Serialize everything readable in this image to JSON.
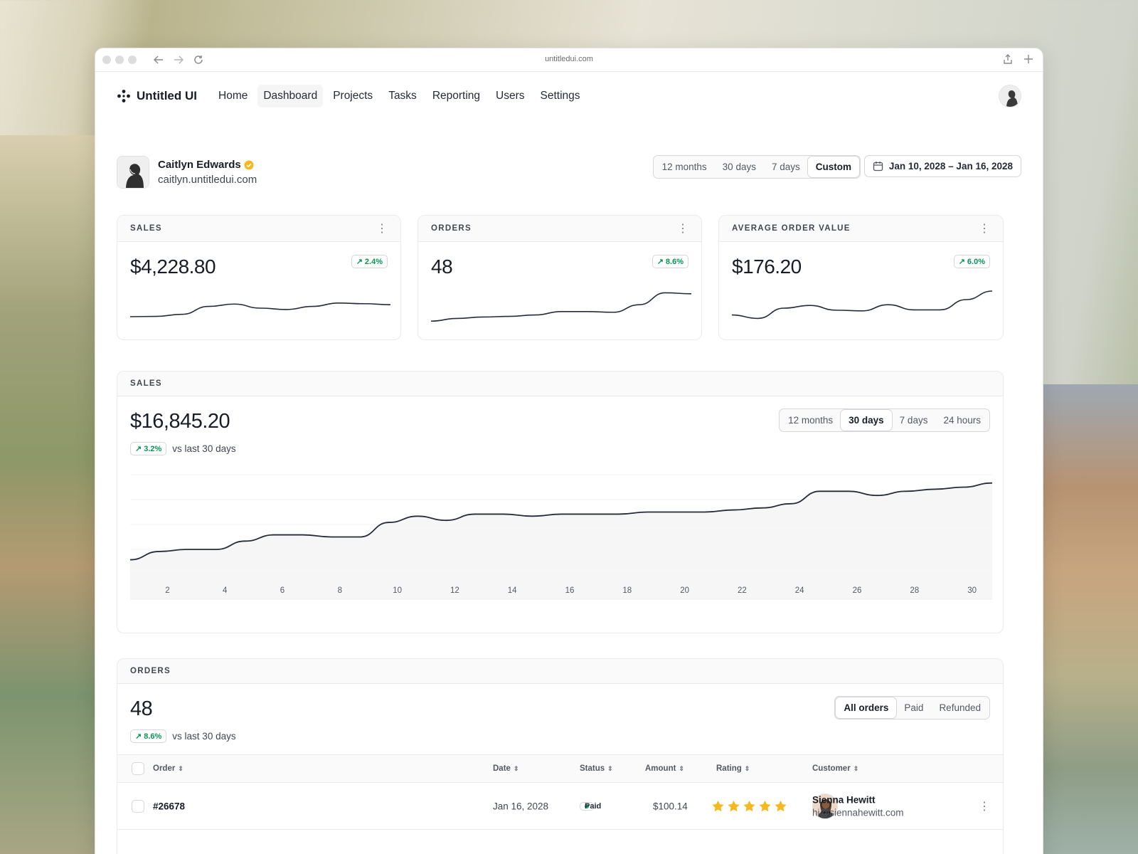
{
  "browser": {
    "url": "untitledui.com"
  },
  "app": {
    "name": "Untitled UI"
  },
  "nav": {
    "items": [
      "Home",
      "Dashboard",
      "Projects",
      "Tasks",
      "Reporting",
      "Users",
      "Settings"
    ],
    "active": "Dashboard"
  },
  "profile": {
    "name": "Caitlyn Edwards",
    "site": "caitlyn.untitledui.com"
  },
  "range_filter": {
    "options": [
      "12 months",
      "30 days",
      "7 days",
      "Custom"
    ],
    "selected": "Custom"
  },
  "date_range": "Jan 10, 2028 – Jan 16, 2028",
  "kpis": [
    {
      "label": "SALES",
      "value": "$4,228.80",
      "change": "2.4%",
      "spark": [
        0.25,
        0.26,
        0.32,
        0.55,
        0.62,
        0.5,
        0.46,
        0.55,
        0.65,
        0.63,
        0.6
      ]
    },
    {
      "label": "ORDERS",
      "value": "48",
      "change": "8.6%",
      "spark": [
        0.12,
        0.2,
        0.24,
        0.26,
        0.3,
        0.4,
        0.4,
        0.38,
        0.6,
        0.95,
        0.92
      ]
    },
    {
      "label": "AVERAGE ORDER VALUE",
      "value": "$176.20",
      "change": "6.0%",
      "spark": [
        0.3,
        0.2,
        0.5,
        0.58,
        0.44,
        0.42,
        0.6,
        0.45,
        0.45,
        0.75,
        1.0
      ]
    }
  ],
  "sales": {
    "label": "SALES",
    "total": "$16,845.20",
    "change": "3.2%",
    "vs_text": "vs last 30 days",
    "tabs": [
      "12 months",
      "30 days",
      "7 days",
      "24 hours"
    ],
    "selected_tab": "30 days"
  },
  "chart_data": {
    "type": "area",
    "x": [
      1,
      2,
      3,
      4,
      5,
      6,
      7,
      8,
      9,
      10,
      11,
      12,
      13,
      14,
      15,
      16,
      17,
      18,
      19,
      20,
      21,
      22,
      23,
      24,
      25,
      26,
      27,
      28,
      29,
      30,
      31
    ],
    "tick_labels": [
      "2",
      "4",
      "6",
      "8",
      "10",
      "12",
      "14",
      "16",
      "18",
      "20",
      "22",
      "24",
      "26",
      "28",
      "30"
    ],
    "series": [
      {
        "values": [
          19,
          23,
          24,
          24,
          28,
          31,
          31,
          30,
          30,
          37,
          40,
          38,
          41,
          41,
          40,
          41,
          41,
          41,
          42,
          42,
          42,
          43,
          44,
          46,
          52,
          52,
          50,
          52,
          53,
          54,
          56
        ]
      }
    ],
    "ylim": [
      0,
      60
    ],
    "grid": true
  },
  "orders": {
    "label": "ORDERS",
    "total": "48",
    "change": "8.6%",
    "vs_text": "vs last 30 days",
    "tabs": [
      "All orders",
      "Paid",
      "Refunded"
    ],
    "selected_tab": "All orders",
    "columns": [
      "Order",
      "Date",
      "Status",
      "Amount",
      "Rating",
      "Customer"
    ],
    "rows": [
      {
        "order": "#26678",
        "date": "Jan 16, 2028",
        "status": "Paid",
        "amount": "$100.14",
        "rating": 5,
        "customer_name": "Sienna Hewitt",
        "customer_email": "hi@siennahewitt.com"
      }
    ]
  },
  "colors": {
    "accent": "#079455",
    "star": "#f5b91f",
    "verified": "#f5b91f",
    "line": "#252b37"
  }
}
